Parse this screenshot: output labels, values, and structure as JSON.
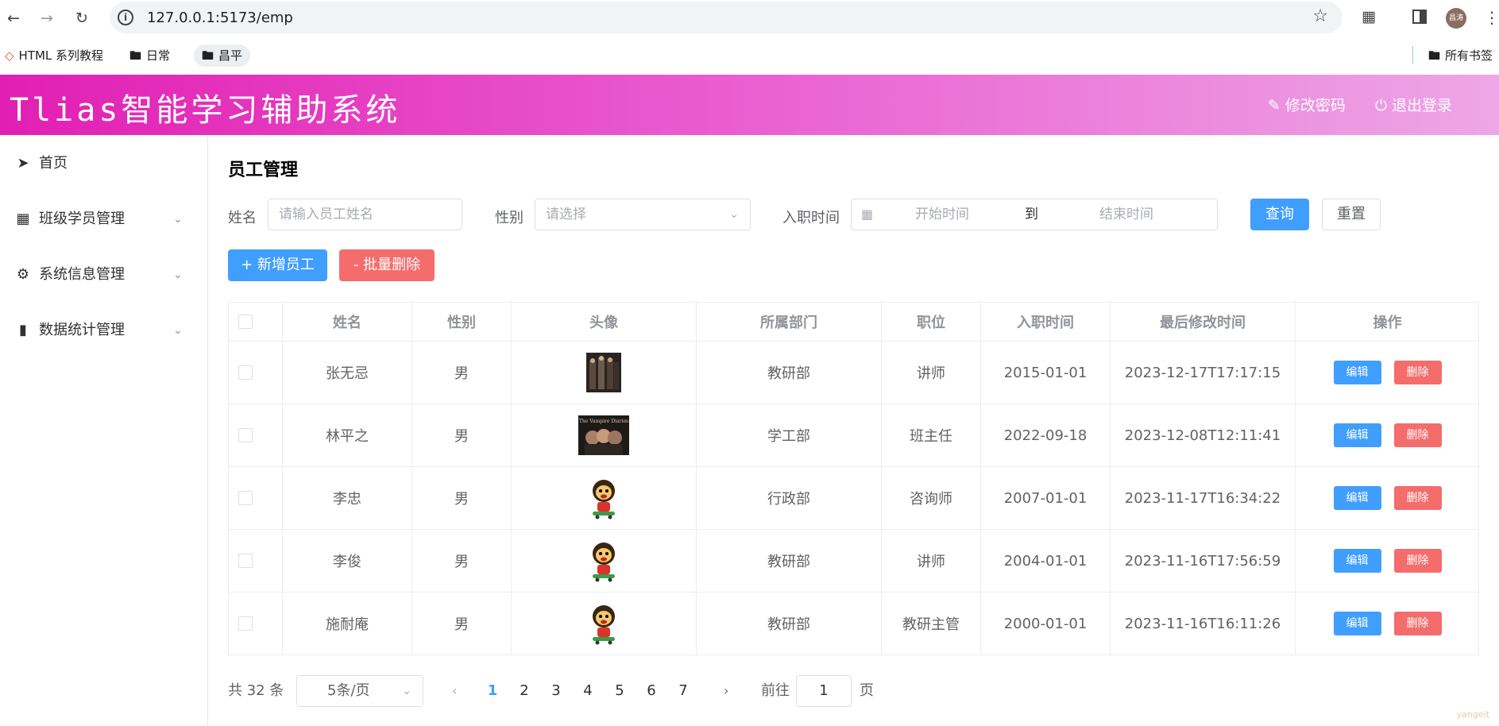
{
  "browser": {
    "url": "127.0.0.1:5173/emp",
    "avatar_text": "昌涛",
    "bookmarks": [
      {
        "label": "HTML 系列教程",
        "icon": "html-logo-icon"
      },
      {
        "label": "日常",
        "icon": "folder-icon"
      },
      {
        "label": "昌平",
        "icon": "folder-icon"
      }
    ],
    "all_bookmarks": "所有书签"
  },
  "header": {
    "title": "Tlias智能学习辅助系统",
    "change_password": "修改密码",
    "logout": "退出登录"
  },
  "sidebar": {
    "items": [
      {
        "label": "首页",
        "icon": "send-icon"
      },
      {
        "label": "班级学员管理",
        "icon": "grid-icon"
      },
      {
        "label": "系统信息管理",
        "icon": "gear-icon"
      },
      {
        "label": "数据统计管理",
        "icon": "bar-chart-icon"
      }
    ]
  },
  "page": {
    "title": "员工管理",
    "filters": {
      "name_label": "姓名",
      "name_placeholder": "请输入员工姓名",
      "gender_label": "性别",
      "gender_placeholder": "请选择",
      "date_label": "入职时间",
      "start_placeholder": "开始时间",
      "range_sep": "到",
      "end_placeholder": "结束时间",
      "query": "查询",
      "reset": "重置"
    },
    "add_button": "+ 新增员工",
    "batch_delete_button": "- 批量删除"
  },
  "table": {
    "headers": [
      "姓名",
      "性别",
      "头像",
      "所属部门",
      "职位",
      "入职时间",
      "最后修改时间",
      "操作"
    ],
    "edit_label": "编辑",
    "delete_label": "删除",
    "rows": [
      {
        "name": "张无忌",
        "gender": "男",
        "avatar": "poster-dark",
        "dept": "教研部",
        "job": "讲师",
        "entry": "2015-01-01",
        "updated": "2023-12-17T17:17:15"
      },
      {
        "name": "林平之",
        "gender": "男",
        "avatar": "poster-wide",
        "dept": "学工部",
        "job": "班主任",
        "entry": "2022-09-18",
        "updated": "2023-12-08T12:11:41"
      },
      {
        "name": "李忠",
        "gender": "男",
        "avatar": "cartoon",
        "dept": "行政部",
        "job": "咨询师",
        "entry": "2007-01-01",
        "updated": "2023-11-17T16:34:22"
      },
      {
        "name": "李俊",
        "gender": "男",
        "avatar": "cartoon",
        "dept": "教研部",
        "job": "讲师",
        "entry": "2004-01-01",
        "updated": "2023-11-16T17:56:59"
      },
      {
        "name": "施耐庵",
        "gender": "男",
        "avatar": "cartoon",
        "dept": "教研部",
        "job": "教研主管",
        "entry": "2000-01-01",
        "updated": "2023-11-16T16:11:26"
      }
    ]
  },
  "pagination": {
    "total": "共 32 条",
    "page_size": "5条/页",
    "pages": [
      "1",
      "2",
      "3",
      "4",
      "5",
      "6",
      "7"
    ],
    "current": "1",
    "goto_label": "前往",
    "goto_value": "1",
    "page_suffix": "页"
  },
  "watermark": "yangeit",
  "colors": {
    "primary": "#409eff",
    "danger": "#f56c6c",
    "header_start": "#e11fb3",
    "header_end": "#eda7e6"
  }
}
